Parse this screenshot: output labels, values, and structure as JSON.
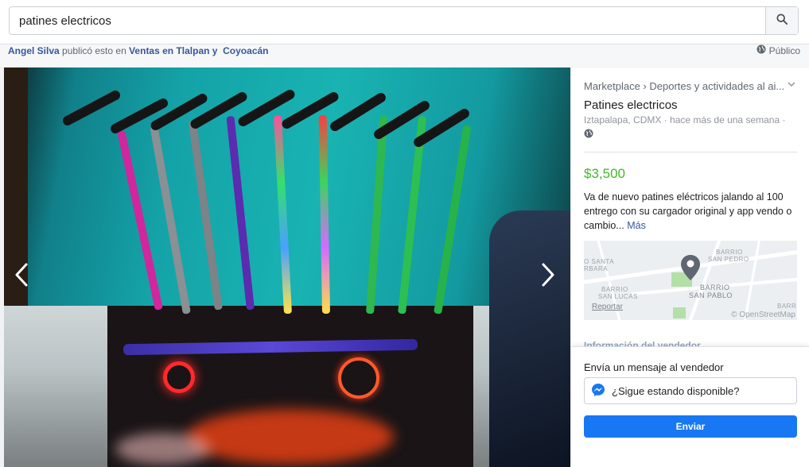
{
  "search": {
    "value": "patines electricos",
    "icon": "magnifier-icon"
  },
  "post_header": {
    "author": "Angel Silva",
    "action": " publicó esto en ",
    "group_part1": "Ventas en Tlalpan y",
    "group_part2": "Coyoacán",
    "privacy": "Público",
    "privacy_icon": "globe-icon"
  },
  "photo": {
    "prev_icon": "chevron-left-icon",
    "next_icon": "chevron-right-icon"
  },
  "listing": {
    "breadcrumb": "Marketplace › Deportes y actividades al ai...",
    "title": "Patines electricos",
    "meta": "Iztapalapa, CDMX · hace más de una semana ·",
    "price": "$3,500",
    "description": "Va de nuevo patines eléctricos jalando al 100 entrego con su cargador original y app vendo o cambio...",
    "more_link": "Más"
  },
  "map": {
    "labels": [
      "O SANTA",
      "RBARA",
      "BARRIO",
      "SAN PEDRO",
      "BARRIO",
      "SAN LUCAS",
      "BARRIO",
      "SAN PABLO",
      "BARR"
    ],
    "report": "Reportar",
    "attribution": "© OpenStreetMap"
  },
  "seller": {
    "section_title": "Información del vendedor"
  },
  "message": {
    "label": "Envía un mensaje al vendedor",
    "input_text": "¿Sigue estando disponible?",
    "send_label": "Enviar",
    "messenger_color": "#1877f2"
  },
  "colors": {
    "accent": "#1877f2",
    "price": "#42b72a",
    "link": "#365899"
  }
}
